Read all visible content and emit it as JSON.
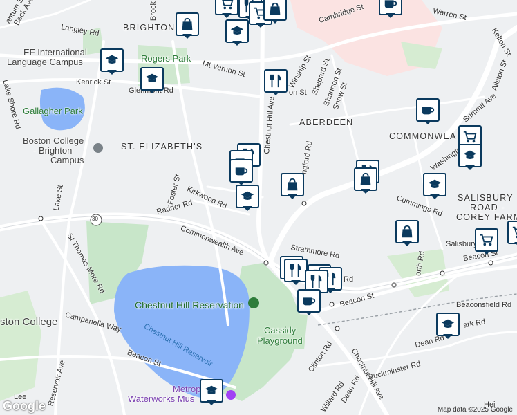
{
  "map": {
    "neighborhoods": [
      {
        "key": "brighton",
        "text": "BRIGHTON"
      },
      {
        "key": "aberdeen",
        "text": "ABERDEEN"
      },
      {
        "key": "st_elizabeths",
        "text": "ST. ELIZABETH'S"
      },
      {
        "key": "commonwealth",
        "text": "COMMONWEA"
      },
      {
        "key": "salisbury_1",
        "text": "SALISBURY"
      },
      {
        "key": "salisbury_2",
        "text": "ROAD -"
      },
      {
        "key": "salisbury_3",
        "text": "COREY FARM"
      }
    ],
    "places": {
      "rogers_park": "Rogers Park",
      "gallagher_park": "Gallagher Park",
      "ef_1": "EF International",
      "ef_2": "Language Campus",
      "bc_brighton_1": "Boston College",
      "bc_brighton_2": "- Brighton",
      "bc_brighton_3": "Campus",
      "reservation": "Chestnut Hill Reservation",
      "reservoir": "Chestnut Hill Reservoir",
      "cassidy_1": "Cassidy",
      "cassidy_2": "Playground",
      "bc": "ston College",
      "museum_1": "Metropo",
      "museum_2": "Waterworks Mus"
    },
    "streets": {
      "cambridge": "Cambridge St",
      "warren": "Warren St",
      "kelton": "Kelton St",
      "allston": "Allston St",
      "langley": "Langley Rd",
      "mt_vernon": "Mt Vernon St",
      "winship": "Winship St",
      "shepard": "Shepard St",
      "shannon": "Shannon St",
      "snow": "Snow St",
      "kenrick": "Kenrick St",
      "glenmont": "Glenmont Rd",
      "lake_shore": "Lake Shore Rd",
      "chestnut_hill_ave": "Chestnut Hill Ave",
      "summit": "Summit Ave",
      "washington": "Washington St",
      "kirkwood": "Kirkwood Rd",
      "radnor": "Radnor Rd",
      "foster": "Foster St",
      "lake": "Lake St",
      "st_thomas_more": "St Thomas More Rd",
      "commonwealth": "Commonwealth Ave",
      "strathmore": "Strathmore Rd",
      "cummings": "Cummings Rd",
      "beacon": "Beacon St",
      "salisbury": "Salisbury",
      "beaconsfield": "Beaconsfield Rd",
      "dean": "Dean Rd",
      "buckminster": "Buckminster Rd",
      "clinton": "Clinton Rd",
      "willard": "Willard Rd",
      "campanella": "Campanella Way",
      "reservoir_ave": "Reservoir Ave",
      "lee": "Lee",
      "route": "30",
      "beck": "Beck Ave",
      "quantum": "antum St",
      "brock": "Brock",
      "kingsford": "ngford Rd",
      "dean_rd2": "Dean Rd",
      "chestnut_hill_ave2": "Chestnut Hill Ave",
      "north": "orth Rd",
      "hei": "Hei",
      "ark": "ark Rd",
      "on_st": "on St",
      "rd": "Rd"
    }
  },
  "markers": [
    {
      "type": "school",
      "label": "education-marker"
    },
    {
      "type": "shopping",
      "label": "shopping-marker"
    },
    {
      "type": "restaurant",
      "label": "restaurant-marker"
    },
    {
      "type": "cafe",
      "label": "cafe-marker"
    },
    {
      "type": "grocery",
      "label": "grocery-marker"
    }
  ],
  "footer": {
    "google": "Google",
    "copyright": "Map data ©2025 Google"
  },
  "colors": {
    "marker_border": "#0b3a5e",
    "park": "#c8e6c9",
    "water": "#8ab4f8",
    "road": "#ffffff",
    "background": "#f1f3f4",
    "campus": "#fce8e6"
  }
}
